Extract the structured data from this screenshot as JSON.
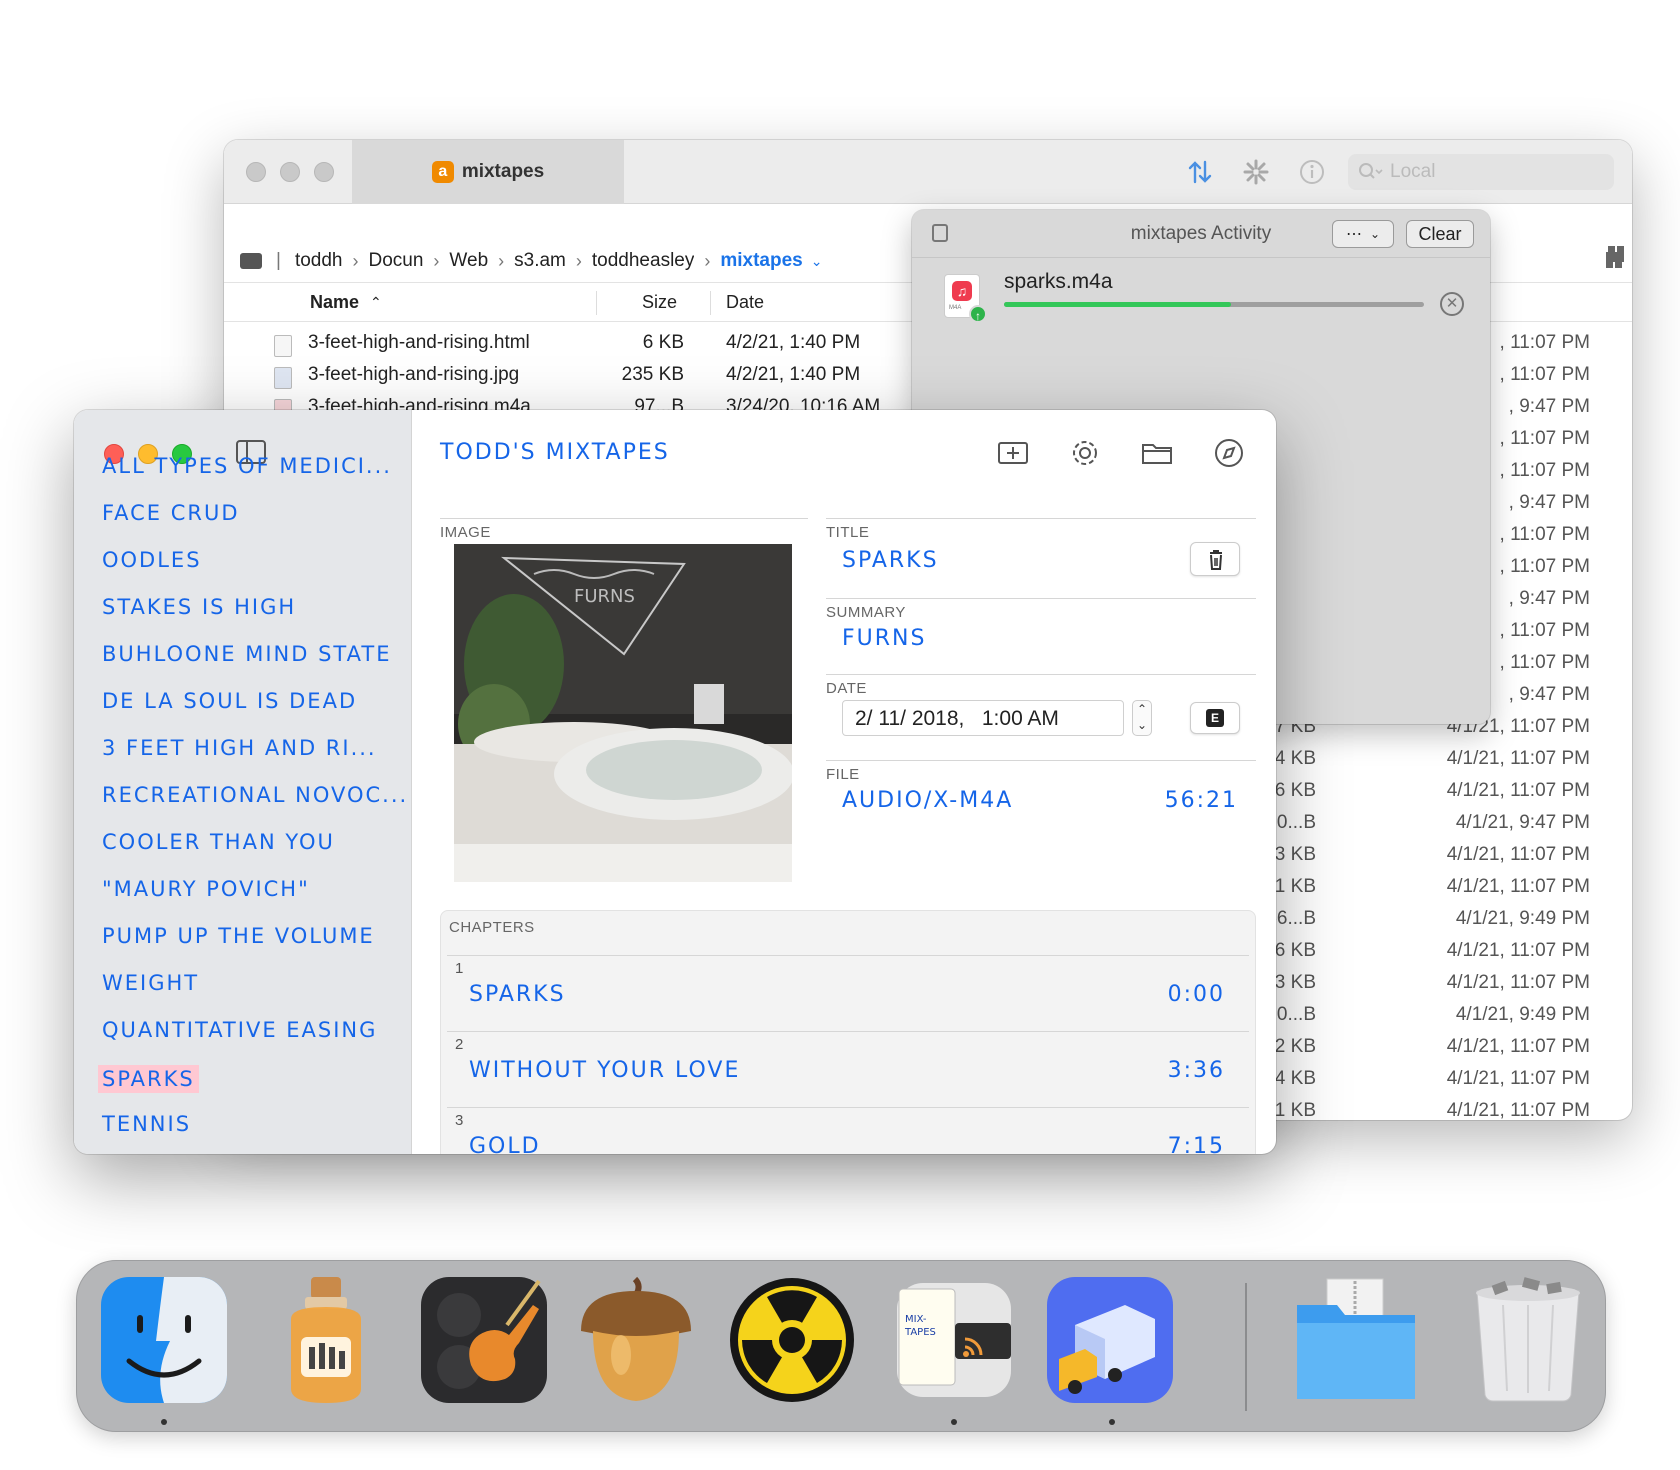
{
  "transmit": {
    "tab_title": "mixtapes",
    "tab_icon_letter": "a",
    "search_placeholder": "Local",
    "breadcrumb": [
      "toddh",
      "Docun",
      "Web",
      "s3.am",
      "toddheasley",
      "mixtapes"
    ],
    "columns": {
      "name": "Name",
      "size": "Size",
      "date": "Date"
    },
    "files": [
      {
        "name": "3-feet-high-and-rising.html",
        "size": "6 KB",
        "date": "4/2/21, 1:40 PM"
      },
      {
        "name": "3-feet-high-and-rising.jpg",
        "size": "235 KB",
        "date": "4/2/21, 1:40 PM"
      },
      {
        "name": "3-feet-high-and-rising.m4a",
        "size": "97...B",
        "date": "3/24/20, 10:16 AM"
      }
    ],
    "right_rows": [
      {
        "size": "",
        "date": ", 11:07 PM"
      },
      {
        "size": "",
        "date": ", 11:07 PM"
      },
      {
        "size": "",
        "date": ", 9:47 PM"
      },
      {
        "size": "",
        "date": ", 11:07 PM"
      },
      {
        "size": "",
        "date": ", 11:07 PM"
      },
      {
        "size": "",
        "date": ", 9:47 PM"
      },
      {
        "size": "",
        "date": ", 11:07 PM"
      },
      {
        "size": "",
        "date": ", 11:07 PM"
      },
      {
        "size": "",
        "date": ", 9:47 PM"
      },
      {
        "size": "",
        "date": ", 11:07 PM"
      },
      {
        "size": "",
        "date": ", 11:07 PM"
      },
      {
        "size": "",
        "date": ", 9:47 PM"
      },
      {
        "size": "17 KB",
        "date": "4/1/21, 11:07 PM"
      },
      {
        "size": "4 KB",
        "date": "4/1/21, 11:07 PM"
      },
      {
        "size": "196 KB",
        "date": "4/1/21, 11:07 PM"
      },
      {
        "size": "70...B",
        "date": "4/1/21, 9:47 PM"
      },
      {
        "size": "3 KB",
        "date": "4/1/21, 11:07 PM"
      },
      {
        "size": "181 KB",
        "date": "4/1/21, 11:07 PM"
      },
      {
        "size": "56...B",
        "date": "4/1/21, 9:49 PM"
      },
      {
        "size": "6 KB",
        "date": "4/1/21, 11:07 PM"
      },
      {
        "size": "163 KB",
        "date": "4/1/21, 11:07 PM"
      },
      {
        "size": "10...B",
        "date": "4/1/21, 9:49 PM"
      },
      {
        "size": "2 KB",
        "date": "4/1/21, 11:07 PM"
      },
      {
        "size": "4 KB",
        "date": "4/1/21, 11:07 PM"
      },
      {
        "size": "31 KB",
        "date": "4/1/21, 11:07 PM"
      }
    ]
  },
  "activity": {
    "title": "mixtapes Activity",
    "clear_label": "Clear",
    "item_name": "sparks.m4a",
    "item_badge": "M4A",
    "progress": 0.54
  },
  "mixtapes": {
    "title": "TODD'S MIXTAPES",
    "sidebar": [
      "ALL TYPES OF MEDICI...",
      "FACE CRUD",
      "OODLES",
      "STAKES IS HIGH",
      "BUHLOONE MIND STATE",
      "DE LA SOUL IS DEAD",
      "3 FEET HIGH AND RI...",
      "RECREATIONAL NOVOC...",
      "COOLER THAN YOU",
      "\"MAURY POVICH\"",
      "PUMP UP THE VOLUME",
      "WEIGHT",
      "QUANTITATIVE EASING",
      "SPARKS",
      "TENNIS"
    ],
    "selected_index": 13,
    "labels": {
      "image": "IMAGE",
      "title": "TITLE",
      "summary": "SUMMARY",
      "date": "DATE",
      "file": "FILE",
      "chapters": "CHAPTERS"
    },
    "fields": {
      "title": "SPARKS",
      "summary": "FURNS",
      "date": "2/ 11/ 2018,   1:00 AM",
      "date_button": "E",
      "file_type": "AUDIO/X-M4A",
      "duration": "56:21"
    },
    "cover_text": "FURNS",
    "chapters": [
      {
        "number": "1",
        "title": "SPARKS",
        "time": "0:00"
      },
      {
        "number": "2",
        "title": "WITHOUT YOUR LOVE",
        "time": "3:36"
      },
      {
        "number": "3",
        "title": "GOLD",
        "time": "7:15"
      }
    ]
  },
  "dock": {
    "apps": [
      "finder-icon",
      "cortex-jar-icon",
      "garageband-icon",
      "acorn-icon",
      "radiation-icon",
      "mixtapes-icon",
      "transmit-icon"
    ],
    "tape_label": "MIX-TAPES",
    "folders": [
      "downloads-folder-icon",
      "trash-icon"
    ]
  },
  "colors": {
    "accent": "#1565e8",
    "selection": "#ffc8d2",
    "progress": "#34c759"
  }
}
